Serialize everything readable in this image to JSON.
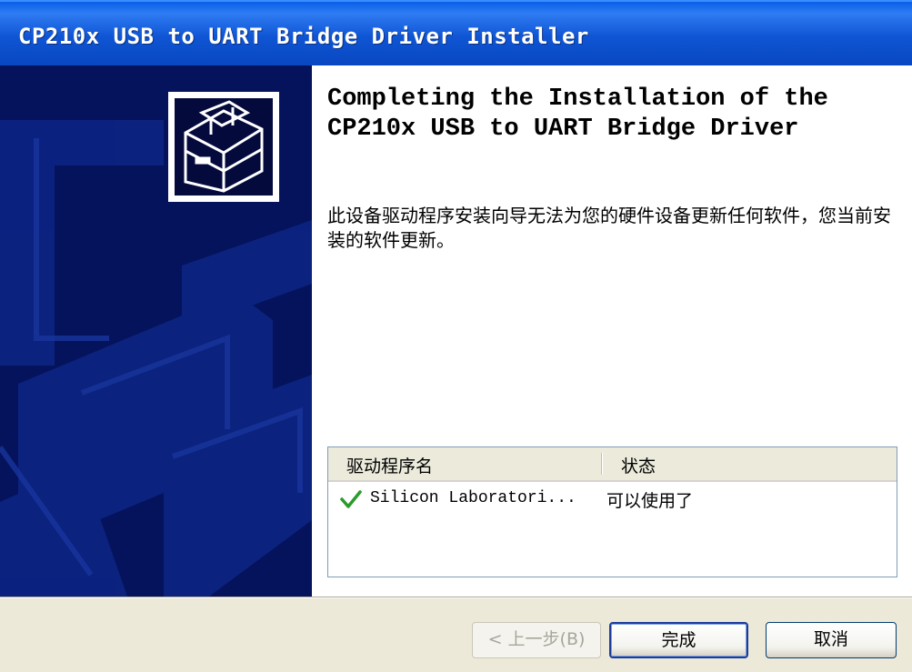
{
  "window": {
    "title": "CP210x USB to UART Bridge Driver Installer"
  },
  "content": {
    "heading": "Completing the Installation of the\nCP210x USB to UART Bridge Driver",
    "message": "此设备驱动程序安装向导无法为您的硬件设备更新任何软件，您当前安装的软件更新。"
  },
  "driver_list": {
    "columns": [
      "驱动程序名",
      "状态"
    ],
    "rows": [
      {
        "icon": "check-icon",
        "name": "Silicon Laboratori...",
        "status": "可以使用了"
      }
    ]
  },
  "buttons": {
    "back": "< 上一步(B)",
    "finish": "完成",
    "cancel": "取消"
  },
  "colors": {
    "titlebar": "#0a5fe8",
    "banner": "#05135c",
    "check": "#2a9c2a"
  }
}
